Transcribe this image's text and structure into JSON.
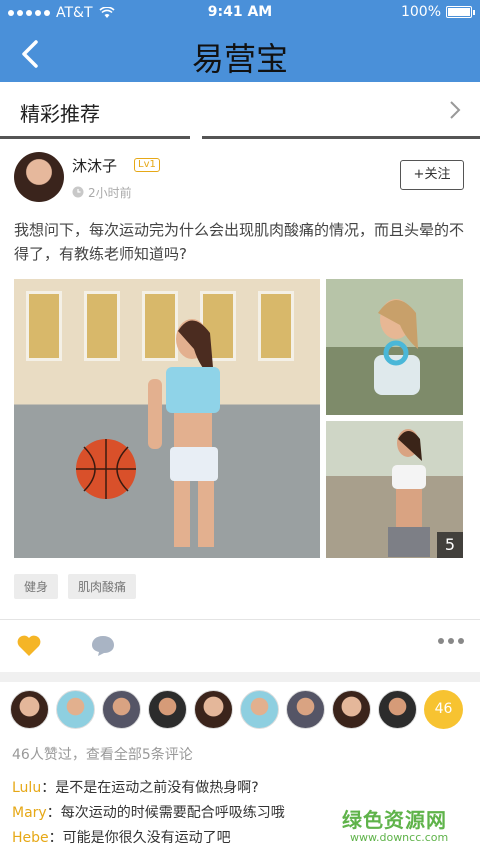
{
  "status_bar": {
    "carrier": "AT&T",
    "time": "9:41 AM",
    "battery": "100%"
  },
  "nav": {
    "title": "易营宝"
  },
  "section": {
    "title": "精彩推荐"
  },
  "post": {
    "user": "沐沐子",
    "level": "Lv1",
    "time": "2小时前",
    "follow_label": "+关注",
    "text": "我想问下，每次运动完为什么会出现肌肉酸痛的情况，而且头晕的不得了，有教练老师知道吗?",
    "photo_more_count": "5",
    "tags": [
      "健身",
      "肌肉酸痛"
    ]
  },
  "likes": {
    "count": "46",
    "summary": "46人赞过，查看全部5条评论"
  },
  "comments": [
    {
      "name": "Lulu",
      "text": "：是不是在运动之前没有做热身啊?"
    },
    {
      "name": "Mary",
      "text": "：每次运动的时候需要配合呼吸练习哦"
    },
    {
      "name": "Hebe",
      "text": "：可能是你很久没有运动了吧"
    }
  ],
  "watermark": {
    "name": "绿色资源网",
    "url": "www.downcc.com"
  },
  "colors": {
    "primary": "#4a90d9",
    "accent": "#f7c331",
    "tag_bg": "#ececec"
  },
  "icons": [
    "signal-dots-icon",
    "wifi-icon",
    "battery-icon",
    "back-arrow-icon",
    "chevron-right-icon",
    "clock-icon",
    "heart-icon",
    "comment-icon",
    "more-icon"
  ]
}
